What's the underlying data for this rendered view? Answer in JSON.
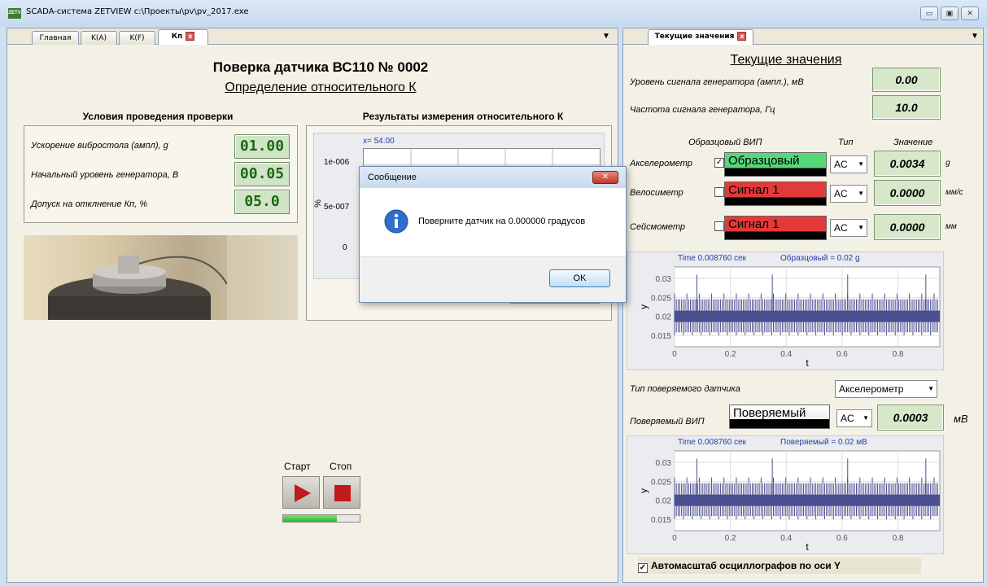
{
  "window": {
    "title": "SCADA-система ZETVIEW c:\\Проекты\\pv\\pv_2017.exe",
    "icon_text": "ZETV"
  },
  "left_tabs": [
    "Главная",
    "K(A)",
    "K(F)",
    "Кп"
  ],
  "right_tabs": [
    "Текущие значения"
  ],
  "main": {
    "title": "Поверка датчика ВС110 № 0002",
    "subtitle": "Определение относительного К",
    "conditions_header": "Условия проведения проверки",
    "results_header": "Результаты измерения относительного К",
    "conditions": [
      {
        "label": "Ускорение вибростола (ампл),   g",
        "value": "01.00"
      },
      {
        "label": "Начальный уровень генератора, В",
        "value": "00.05"
      },
      {
        "label": "Допуск на отклнение Кп, %",
        "value": "05.0"
      }
    ],
    "results_chart": {
      "cursor": "x= 54.00",
      "ylabel": "%",
      "ticks": [
        "1e-006",
        "5e-007",
        "0"
      ]
    },
    "start_label": "Старт",
    "stop_label": "Стоп",
    "progress": 0.7
  },
  "dialog": {
    "title": "Сообщение",
    "message": "Поверните датчик на 0.000000 градусов",
    "ok": "OK"
  },
  "current": {
    "title": "Текущие значения",
    "gen_level_label": "Уровень сигнала генератора (ампл.), мВ",
    "gen_level": "0.00",
    "gen_freq_label": "Частота сигнала генератора, Гц",
    "gen_freq": "10.0",
    "col_ref": "Образцовый ВИП",
    "col_type": "Тип",
    "col_value": "Значение",
    "sensors": [
      {
        "name": "Акселерометр",
        "signal": "Образцовый",
        "checked": true,
        "type": "AC",
        "value": "0.0034",
        "unit": "g",
        "color": "#58d77a"
      },
      {
        "name": "Велосиметр",
        "signal": "Сигнал 1",
        "checked": false,
        "type": "AC",
        "value": "0.0000",
        "unit": "мм/с",
        "color": "#e23a3a"
      },
      {
        "name": "Сейсмометр",
        "signal": "Сигнал 1",
        "checked": false,
        "type": "AC",
        "value": "0.0000",
        "unit": "мм",
        "color": "#e23a3a"
      }
    ],
    "scope1": {
      "time": "Time 0.008760 сек",
      "readout": "Образцовый = 0.02 g",
      "yticks": [
        "0.03",
        "0.025",
        "0.02",
        "0.015"
      ],
      "xticks": [
        "0",
        "0.2",
        "0.4",
        "0.6",
        "0.8"
      ],
      "xlabel": "t",
      "ylabel": "y"
    },
    "sensor_type_label": "Тип поверяемого датчика",
    "sensor_type": "Акселерометр",
    "dut_label": "Поверяемый ВИП",
    "dut_signal": "Поверяемый",
    "dut_type": "AC",
    "dut_value": "0.0003",
    "dut_unit": "мВ",
    "scope2": {
      "time": "Time 0.008760 сек",
      "readout": "Поверяемый = 0.02 мВ",
      "yticks": [
        "0.03",
        "0.025",
        "0.02",
        "0.015"
      ],
      "xticks": [
        "0",
        "0.2",
        "0.4",
        "0.6",
        "0.8"
      ],
      "xlabel": "t",
      "ylabel": "y"
    },
    "autoscale_label": "Автомасштаб осциллографов по оси Y",
    "autoscale_checked": true
  }
}
